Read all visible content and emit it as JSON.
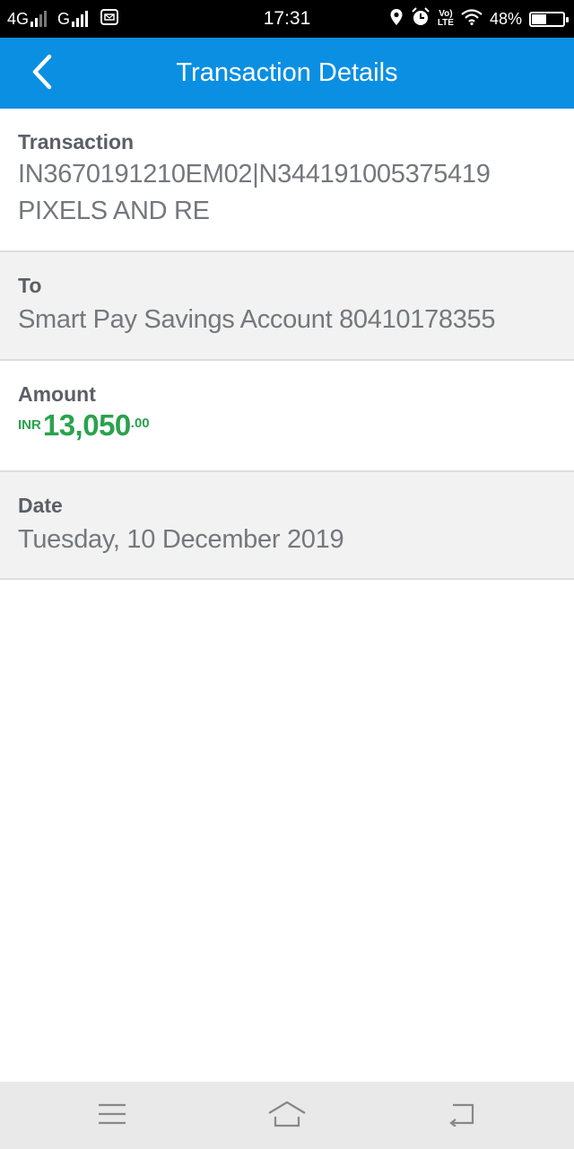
{
  "status_bar": {
    "network1": "4G",
    "network2": "G",
    "time": "17:31",
    "volte_top": "Vo)",
    "volte_bottom": "LTE",
    "battery": "48%",
    "battery_level": 0.48
  },
  "header": {
    "title": "Transaction Details",
    "back_icon": "chevron-left-icon",
    "background_color": "#0b8fe2"
  },
  "details": {
    "transaction": {
      "label": "Transaction",
      "line1": "IN3670191210EM02|N344191005375419",
      "line2": "PIXELS AND RE"
    },
    "to": {
      "label": "To",
      "value": "Smart Pay Savings Account 80410178355"
    },
    "amount": {
      "label": "Amount",
      "currency": "INR",
      "whole": "13,050",
      "decimal": ".00",
      "color": "#2aa24e"
    },
    "date": {
      "label": "Date",
      "value": "Tuesday, 10 December 2019"
    }
  },
  "nav_bar": {
    "menu_icon": "menu-icon",
    "home_icon": "home-icon",
    "back_icon": "back-icon"
  }
}
